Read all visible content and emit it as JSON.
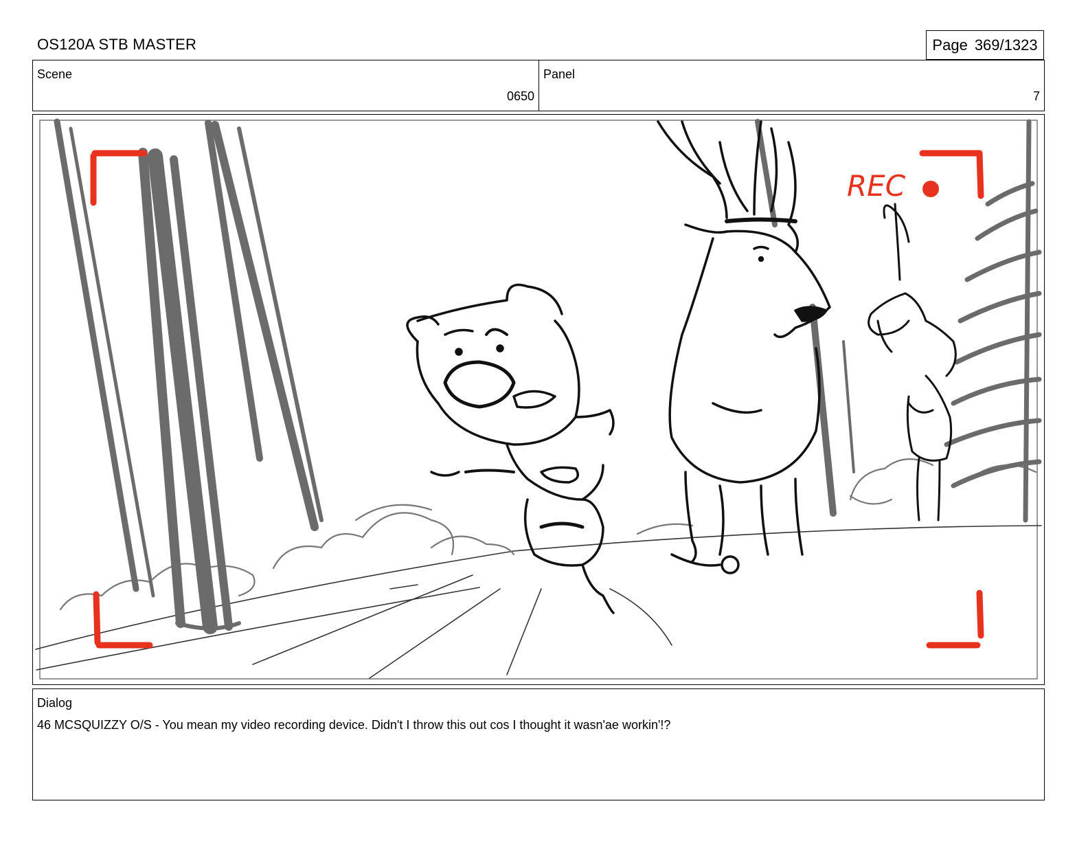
{
  "header": {
    "title": "OS120A STB MASTER",
    "page_label": "Page",
    "page_value": "369/1323"
  },
  "info": {
    "scene_label": "Scene",
    "scene_value": "0650",
    "panel_label": "Panel",
    "panel_value": "7"
  },
  "panel": {
    "rec_label": "REC",
    "overlay_color": "#e8321e",
    "ink_color": "#111111",
    "tree_color": "#6b6b6b"
  },
  "dialog": {
    "label": "Dialog",
    "text": "46 MCSQUIZZY O/S - You mean my video recording device. Didn't I throw this out cos I thought it wasn'ae workin'!?"
  }
}
